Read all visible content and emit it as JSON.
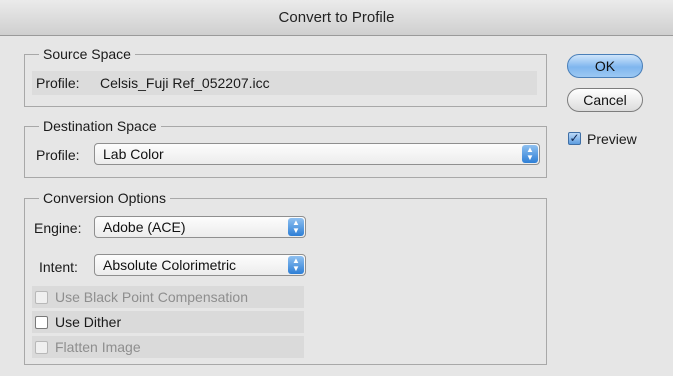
{
  "window": {
    "title": "Convert to Profile"
  },
  "source_space": {
    "legend": "Source Space",
    "profile_label": "Profile:",
    "profile_value": "Celsis_Fuji Ref_052207.icc"
  },
  "destination_space": {
    "legend": "Destination Space",
    "profile_label": "Profile:",
    "profile_value": "Lab Color"
  },
  "conversion_options": {
    "legend": "Conversion Options",
    "engine_label": "Engine:",
    "engine_value": "Adobe (ACE)",
    "intent_label": "Intent:",
    "intent_value": "Absolute Colorimetric",
    "black_point_label": "Use Black Point Compensation",
    "black_point_checked": false,
    "black_point_enabled": false,
    "dither_label": "Use Dither",
    "dither_checked": false,
    "dither_enabled": true,
    "flatten_label": "Flatten Image",
    "flatten_checked": false,
    "flatten_enabled": false
  },
  "buttons": {
    "ok": "OK",
    "cancel": "Cancel"
  },
  "preview": {
    "label": "Preview",
    "checked": true
  }
}
